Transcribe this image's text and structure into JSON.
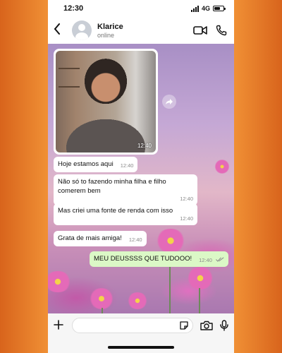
{
  "status_bar": {
    "time": "12:30",
    "network": "4G"
  },
  "header": {
    "back_icon": "chevron-left-icon",
    "contact_name": "Klarice",
    "contact_status": "online"
  },
  "chat": {
    "photo_message": {
      "time": "12:40"
    },
    "messages": [
      {
        "text": "Hoje estamos aqui",
        "time": "12:40",
        "direction": "incoming"
      },
      {
        "text": "Não só to fazendo minha filha e filho comerem bem",
        "time": "12:40",
        "direction": "incoming"
      },
      {
        "text": "Mas criei uma fonte de renda com isso",
        "time": "12:40",
        "direction": "incoming"
      },
      {
        "text": "Grata de mais amiga!",
        "time": "12:40",
        "direction": "incoming"
      },
      {
        "text": "MEU DEUSSSS QUE TUDOOO!",
        "time": "12:40",
        "direction": "outgoing"
      }
    ]
  },
  "colors": {
    "outgoing_bubble": "#dbf8c6",
    "incoming_bubble": "#ffffff",
    "frame": "#ee8a33"
  }
}
